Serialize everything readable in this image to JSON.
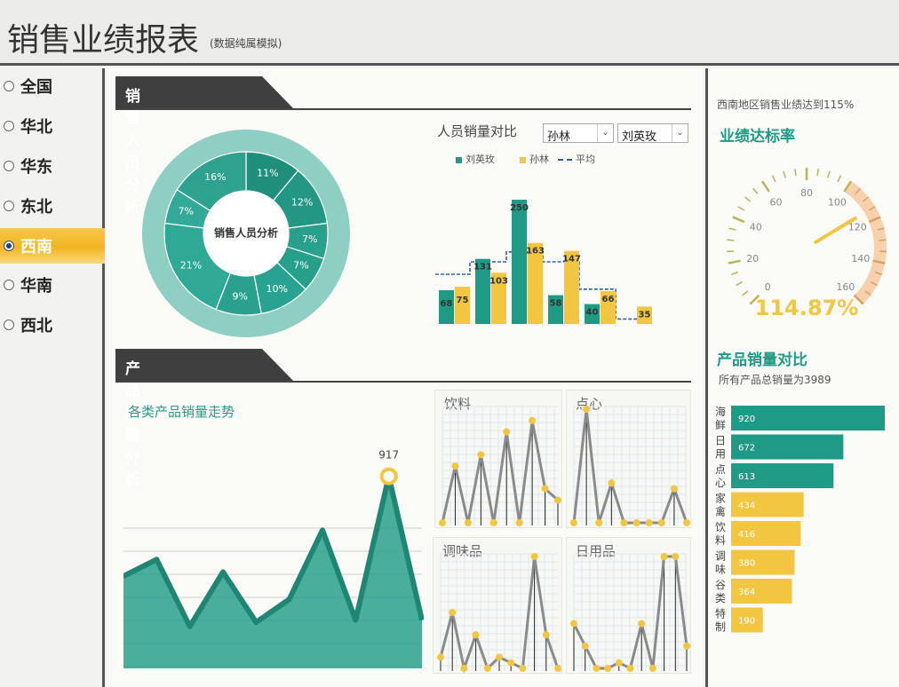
{
  "header": {
    "title": "销售业绩报表",
    "subtitle": "(数据纯属模拟)"
  },
  "sidebar": {
    "items": [
      {
        "label": "全国",
        "active": false
      },
      {
        "label": "华北",
        "active": false
      },
      {
        "label": "华东",
        "active": false
      },
      {
        "label": "东北",
        "active": false
      },
      {
        "label": "西南",
        "active": true
      },
      {
        "label": "华南",
        "active": false
      },
      {
        "label": "西北",
        "active": false
      }
    ]
  },
  "sales_people": {
    "section_title": "销售人员分析",
    "donut": {
      "center_label": "销售人员分析",
      "slices": [
        {
          "label": "11%",
          "value": 11,
          "color": "#1f8f7b"
        },
        {
          "label": "12%",
          "value": 12,
          "color": "#239784"
        },
        {
          "label": "7%",
          "value": 7,
          "color": "#2a9f8c"
        },
        {
          "label": "7%",
          "value": 7,
          "color": "#26a08a"
        },
        {
          "label": "10%",
          "value": 10,
          "color": "#29a391"
        },
        {
          "label": "9%",
          "value": 9,
          "color": "#2aa18f"
        },
        {
          "label": "21%",
          "value": 21,
          "color": "#2fa896"
        },
        {
          "label": "7%",
          "value": 7,
          "color": "#33a999"
        },
        {
          "label": "16%",
          "value": 16,
          "color": "#2ea18f"
        }
      ]
    },
    "compare": {
      "title": "人员销量对比",
      "select_a": "孙林",
      "select_b": "刘英玫",
      "legend": {
        "a": "刘英玫",
        "b": "孙林",
        "avg": "平均"
      },
      "colors": {
        "a": "#1f9a86",
        "b": "#f2c640",
        "avg": "#2e5ea8"
      }
    }
  },
  "product": {
    "section_title": "产品销量分析",
    "trend_title": "各类产品销量走势",
    "peak_label": "917",
    "panels": [
      {
        "title": "饮料"
      },
      {
        "title": "点心"
      },
      {
        "title": "调味品"
      },
      {
        "title": "日用品"
      }
    ]
  },
  "right": {
    "achieve_note": "西南地区销售业绩达到115%",
    "gauge_title": "业绩达标率",
    "gauge_value_text": "114.87%",
    "gauge_ticks": [
      "0",
      "20",
      "40",
      "60",
      "80",
      "100",
      "120",
      "140",
      "160"
    ],
    "compare_title": "产品销量对比",
    "total_note": "所有产品总销量为3989",
    "bar_colors": {
      "top": "#1f9a86",
      "rest": "#f2c640"
    }
  },
  "chart_data": [
    {
      "type": "bar",
      "title": "人员销量对比",
      "categories": [
        "1",
        "2",
        "3",
        "4",
        "5",
        "6"
      ],
      "series": [
        {
          "name": "刘英玫",
          "values": [
            68,
            131,
            250,
            58,
            40,
            null
          ]
        },
        {
          "name": "孙林",
          "values": [
            75,
            103,
            163,
            147,
            66,
            35
          ]
        },
        {
          "name": "平均",
          "type": "line",
          "values": [
            100,
            125,
            145,
            125,
            70,
            10
          ]
        }
      ],
      "ylim": [
        0,
        280
      ]
    },
    {
      "type": "area",
      "title": "各类产品销量走势",
      "x": [
        1,
        2,
        3,
        4,
        5,
        6,
        7,
        8,
        9,
        10
      ],
      "values": [
        440,
        520,
        200,
        460,
        220,
        330,
        660,
        230,
        917,
        230
      ],
      "ylim": [
        0,
        1000
      ]
    },
    {
      "type": "line",
      "title": "饮料",
      "values": [
        0,
        50,
        0,
        60,
        0,
        80,
        0,
        90,
        30,
        20
      ]
    },
    {
      "type": "line",
      "title": "点心",
      "values": [
        0,
        100,
        0,
        35,
        0,
        0,
        0,
        0,
        30,
        0
      ]
    },
    {
      "type": "line",
      "title": "调味品",
      "values": [
        10,
        50,
        0,
        30,
        0,
        10,
        5,
        0,
        100,
        30,
        0
      ]
    },
    {
      "type": "line",
      "title": "日用品",
      "values": [
        40,
        20,
        0,
        0,
        5,
        0,
        40,
        0,
        100,
        100,
        20
      ]
    },
    {
      "type": "gauge",
      "title": "业绩达标率",
      "value": 114.87,
      "range": [
        0,
        160
      ]
    },
    {
      "type": "bar",
      "orientation": "horizontal",
      "title": "产品销量对比",
      "categories": [
        "海鲜",
        "日用",
        "点心",
        "家禽",
        "饮料",
        "调味",
        "谷类",
        "特制"
      ],
      "values": [
        920,
        672,
        613,
        434,
        416,
        380,
        364,
        190
      ]
    }
  ]
}
